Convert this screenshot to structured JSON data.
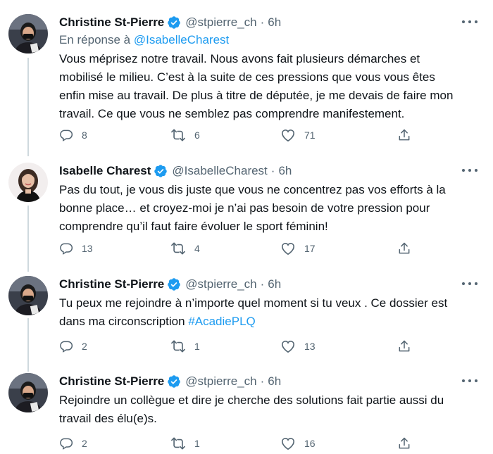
{
  "colors": {
    "link": "#1d9bf0",
    "secondary": "#536471",
    "text": "#0f1419",
    "verified": "#1d9bf0"
  },
  "tweets": [
    {
      "author": "Christine St-Pierre",
      "handle": "@stpierre_ch",
      "separator": "·",
      "time": "6h",
      "reply_prefix": "En réponse à",
      "reply_mention": "@IsabelleCharest",
      "lines": [
        "Vous méprisez notre travail. Nous avons fait plusieurs démarches et",
        "mobilisé le milieu. C’est à la suite de ces pressions que vous vous êtes",
        "enfin mise au travail. De plus à titre de députée, je me devais de faire mon",
        "travail. Ce que vous ne semblez pas comprendre manifestement."
      ],
      "replies": "8",
      "retweets": "6",
      "likes": "71"
    },
    {
      "author": "Isabelle Charest",
      "handle": "@IsabelleCharest",
      "separator": "·",
      "time": "6h",
      "lines": [
        "Pas du tout, je vous dis juste que vous ne concentrez pas vos efforts à la",
        "bonne place… et croyez-moi je n’ai pas besoin de votre pression pour",
        "comprendre qu’il faut faire évoluer le sport féminin!"
      ],
      "replies": "13",
      "retweets": "4",
      "likes": "17"
    },
    {
      "author": "Christine St-Pierre",
      "handle": "@stpierre_ch",
      "separator": "·",
      "time": "6h",
      "lines": [
        "Tu peux me rejoindre à n’importe quel moment si tu veux . Ce dossier est"
      ],
      "line2_prefix": "dans ma circonscription ",
      "hashtag": "#AcadiePLQ",
      "replies": "2",
      "retweets": "1",
      "likes": "13"
    },
    {
      "author": "Christine St-Pierre",
      "handle": "@stpierre_ch",
      "separator": "·",
      "time": "6h",
      "lines": [
        "Rejoindre un collègue et dire je cherche des solutions fait partie aussi du",
        "travail des élu(e)s."
      ],
      "replies": "2",
      "retweets": "1",
      "likes": "16"
    }
  ]
}
